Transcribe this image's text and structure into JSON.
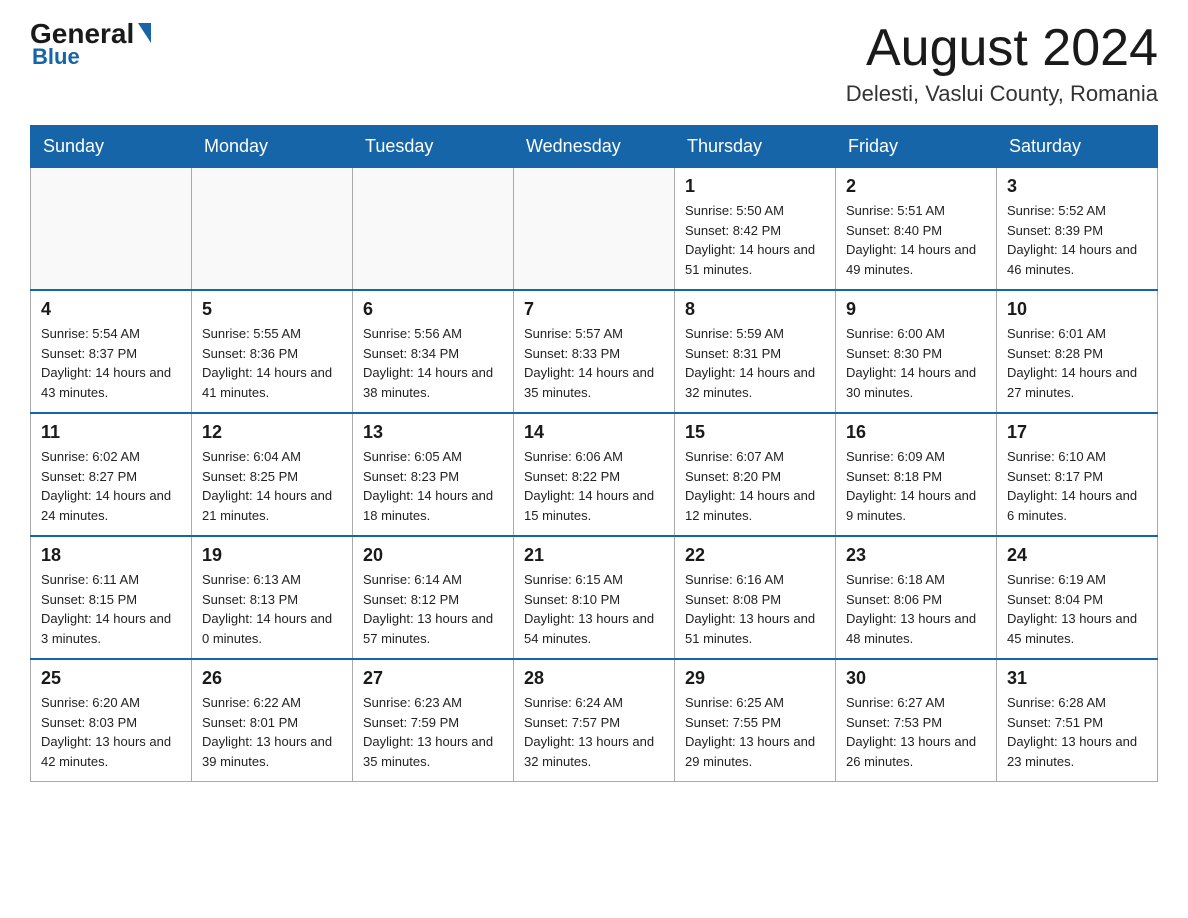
{
  "header": {
    "logo_general": "General",
    "logo_blue": "Blue",
    "month_title": "August 2024",
    "location": "Delesti, Vaslui County, Romania"
  },
  "days_of_week": [
    "Sunday",
    "Monday",
    "Tuesday",
    "Wednesday",
    "Thursday",
    "Friday",
    "Saturday"
  ],
  "weeks": [
    [
      {
        "day": "",
        "info": ""
      },
      {
        "day": "",
        "info": ""
      },
      {
        "day": "",
        "info": ""
      },
      {
        "day": "",
        "info": ""
      },
      {
        "day": "1",
        "info": "Sunrise: 5:50 AM\nSunset: 8:42 PM\nDaylight: 14 hours and 51 minutes."
      },
      {
        "day": "2",
        "info": "Sunrise: 5:51 AM\nSunset: 8:40 PM\nDaylight: 14 hours and 49 minutes."
      },
      {
        "day": "3",
        "info": "Sunrise: 5:52 AM\nSunset: 8:39 PM\nDaylight: 14 hours and 46 minutes."
      }
    ],
    [
      {
        "day": "4",
        "info": "Sunrise: 5:54 AM\nSunset: 8:37 PM\nDaylight: 14 hours and 43 minutes."
      },
      {
        "day": "5",
        "info": "Sunrise: 5:55 AM\nSunset: 8:36 PM\nDaylight: 14 hours and 41 minutes."
      },
      {
        "day": "6",
        "info": "Sunrise: 5:56 AM\nSunset: 8:34 PM\nDaylight: 14 hours and 38 minutes."
      },
      {
        "day": "7",
        "info": "Sunrise: 5:57 AM\nSunset: 8:33 PM\nDaylight: 14 hours and 35 minutes."
      },
      {
        "day": "8",
        "info": "Sunrise: 5:59 AM\nSunset: 8:31 PM\nDaylight: 14 hours and 32 minutes."
      },
      {
        "day": "9",
        "info": "Sunrise: 6:00 AM\nSunset: 8:30 PM\nDaylight: 14 hours and 30 minutes."
      },
      {
        "day": "10",
        "info": "Sunrise: 6:01 AM\nSunset: 8:28 PM\nDaylight: 14 hours and 27 minutes."
      }
    ],
    [
      {
        "day": "11",
        "info": "Sunrise: 6:02 AM\nSunset: 8:27 PM\nDaylight: 14 hours and 24 minutes."
      },
      {
        "day": "12",
        "info": "Sunrise: 6:04 AM\nSunset: 8:25 PM\nDaylight: 14 hours and 21 minutes."
      },
      {
        "day": "13",
        "info": "Sunrise: 6:05 AM\nSunset: 8:23 PM\nDaylight: 14 hours and 18 minutes."
      },
      {
        "day": "14",
        "info": "Sunrise: 6:06 AM\nSunset: 8:22 PM\nDaylight: 14 hours and 15 minutes."
      },
      {
        "day": "15",
        "info": "Sunrise: 6:07 AM\nSunset: 8:20 PM\nDaylight: 14 hours and 12 minutes."
      },
      {
        "day": "16",
        "info": "Sunrise: 6:09 AM\nSunset: 8:18 PM\nDaylight: 14 hours and 9 minutes."
      },
      {
        "day": "17",
        "info": "Sunrise: 6:10 AM\nSunset: 8:17 PM\nDaylight: 14 hours and 6 minutes."
      }
    ],
    [
      {
        "day": "18",
        "info": "Sunrise: 6:11 AM\nSunset: 8:15 PM\nDaylight: 14 hours and 3 minutes."
      },
      {
        "day": "19",
        "info": "Sunrise: 6:13 AM\nSunset: 8:13 PM\nDaylight: 14 hours and 0 minutes."
      },
      {
        "day": "20",
        "info": "Sunrise: 6:14 AM\nSunset: 8:12 PM\nDaylight: 13 hours and 57 minutes."
      },
      {
        "day": "21",
        "info": "Sunrise: 6:15 AM\nSunset: 8:10 PM\nDaylight: 13 hours and 54 minutes."
      },
      {
        "day": "22",
        "info": "Sunrise: 6:16 AM\nSunset: 8:08 PM\nDaylight: 13 hours and 51 minutes."
      },
      {
        "day": "23",
        "info": "Sunrise: 6:18 AM\nSunset: 8:06 PM\nDaylight: 13 hours and 48 minutes."
      },
      {
        "day": "24",
        "info": "Sunrise: 6:19 AM\nSunset: 8:04 PM\nDaylight: 13 hours and 45 minutes."
      }
    ],
    [
      {
        "day": "25",
        "info": "Sunrise: 6:20 AM\nSunset: 8:03 PM\nDaylight: 13 hours and 42 minutes."
      },
      {
        "day": "26",
        "info": "Sunrise: 6:22 AM\nSunset: 8:01 PM\nDaylight: 13 hours and 39 minutes."
      },
      {
        "day": "27",
        "info": "Sunrise: 6:23 AM\nSunset: 7:59 PM\nDaylight: 13 hours and 35 minutes."
      },
      {
        "day": "28",
        "info": "Sunrise: 6:24 AM\nSunset: 7:57 PM\nDaylight: 13 hours and 32 minutes."
      },
      {
        "day": "29",
        "info": "Sunrise: 6:25 AM\nSunset: 7:55 PM\nDaylight: 13 hours and 29 minutes."
      },
      {
        "day": "30",
        "info": "Sunrise: 6:27 AM\nSunset: 7:53 PM\nDaylight: 13 hours and 26 minutes."
      },
      {
        "day": "31",
        "info": "Sunrise: 6:28 AM\nSunset: 7:51 PM\nDaylight: 13 hours and 23 minutes."
      }
    ]
  ]
}
